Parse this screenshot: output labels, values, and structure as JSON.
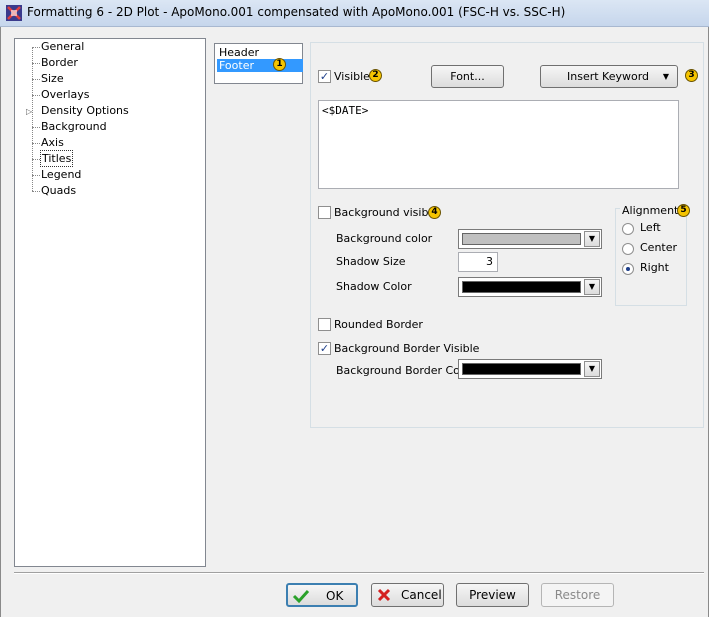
{
  "window": {
    "title": "Formatting 6 - 2D Plot - ApoMono.001 compensated with ApoMono.001 (FSC-H vs. SSC-H)"
  },
  "nav_tree": {
    "items": [
      {
        "label": "General"
      },
      {
        "label": "Border"
      },
      {
        "label": "Size"
      },
      {
        "label": "Overlays"
      },
      {
        "label": "Density Options"
      },
      {
        "label": "Background"
      },
      {
        "label": "Axis"
      },
      {
        "label": "Titles"
      },
      {
        "label": "Legend"
      },
      {
        "label": "Quads"
      }
    ],
    "selected": "Titles"
  },
  "titles_list": {
    "items": [
      {
        "label": "Header"
      },
      {
        "label": "Footer"
      }
    ],
    "selected": "Footer"
  },
  "callouts": [
    "1",
    "2",
    "3",
    "4",
    "5"
  ],
  "settings": {
    "visible": {
      "label": "Visible",
      "checked": true
    },
    "font_button": "Font...",
    "insert_keyword_button": "Insert Keyword",
    "title_text": "<$DATE>",
    "background_visible": {
      "label": "Background visible",
      "checked": false
    },
    "background_color": {
      "label": "Background color",
      "color": "#c0c0c0"
    },
    "shadow_size": {
      "label": "Shadow Size",
      "value": "3"
    },
    "shadow_color": {
      "label": "Shadow Color",
      "color": "#000000"
    },
    "rounded_border": {
      "label": "Rounded Border",
      "checked": false
    },
    "background_border_visible": {
      "label": "Background Border Visible",
      "checked": true
    },
    "background_border_color": {
      "label": "Background Border Color",
      "color": "#000000"
    }
  },
  "alignment": {
    "title": "Alignment",
    "options": [
      {
        "label": "Left"
      },
      {
        "label": "Center"
      },
      {
        "label": "Right"
      }
    ],
    "selected": "Right"
  },
  "buttons": {
    "ok": "OK",
    "cancel": "Cancel",
    "preview": "Preview",
    "restore": "Restore"
  },
  "colors": {
    "selection": "#3399ff",
    "callout": "#f5c400",
    "check_mark": "#1e3f8a"
  }
}
